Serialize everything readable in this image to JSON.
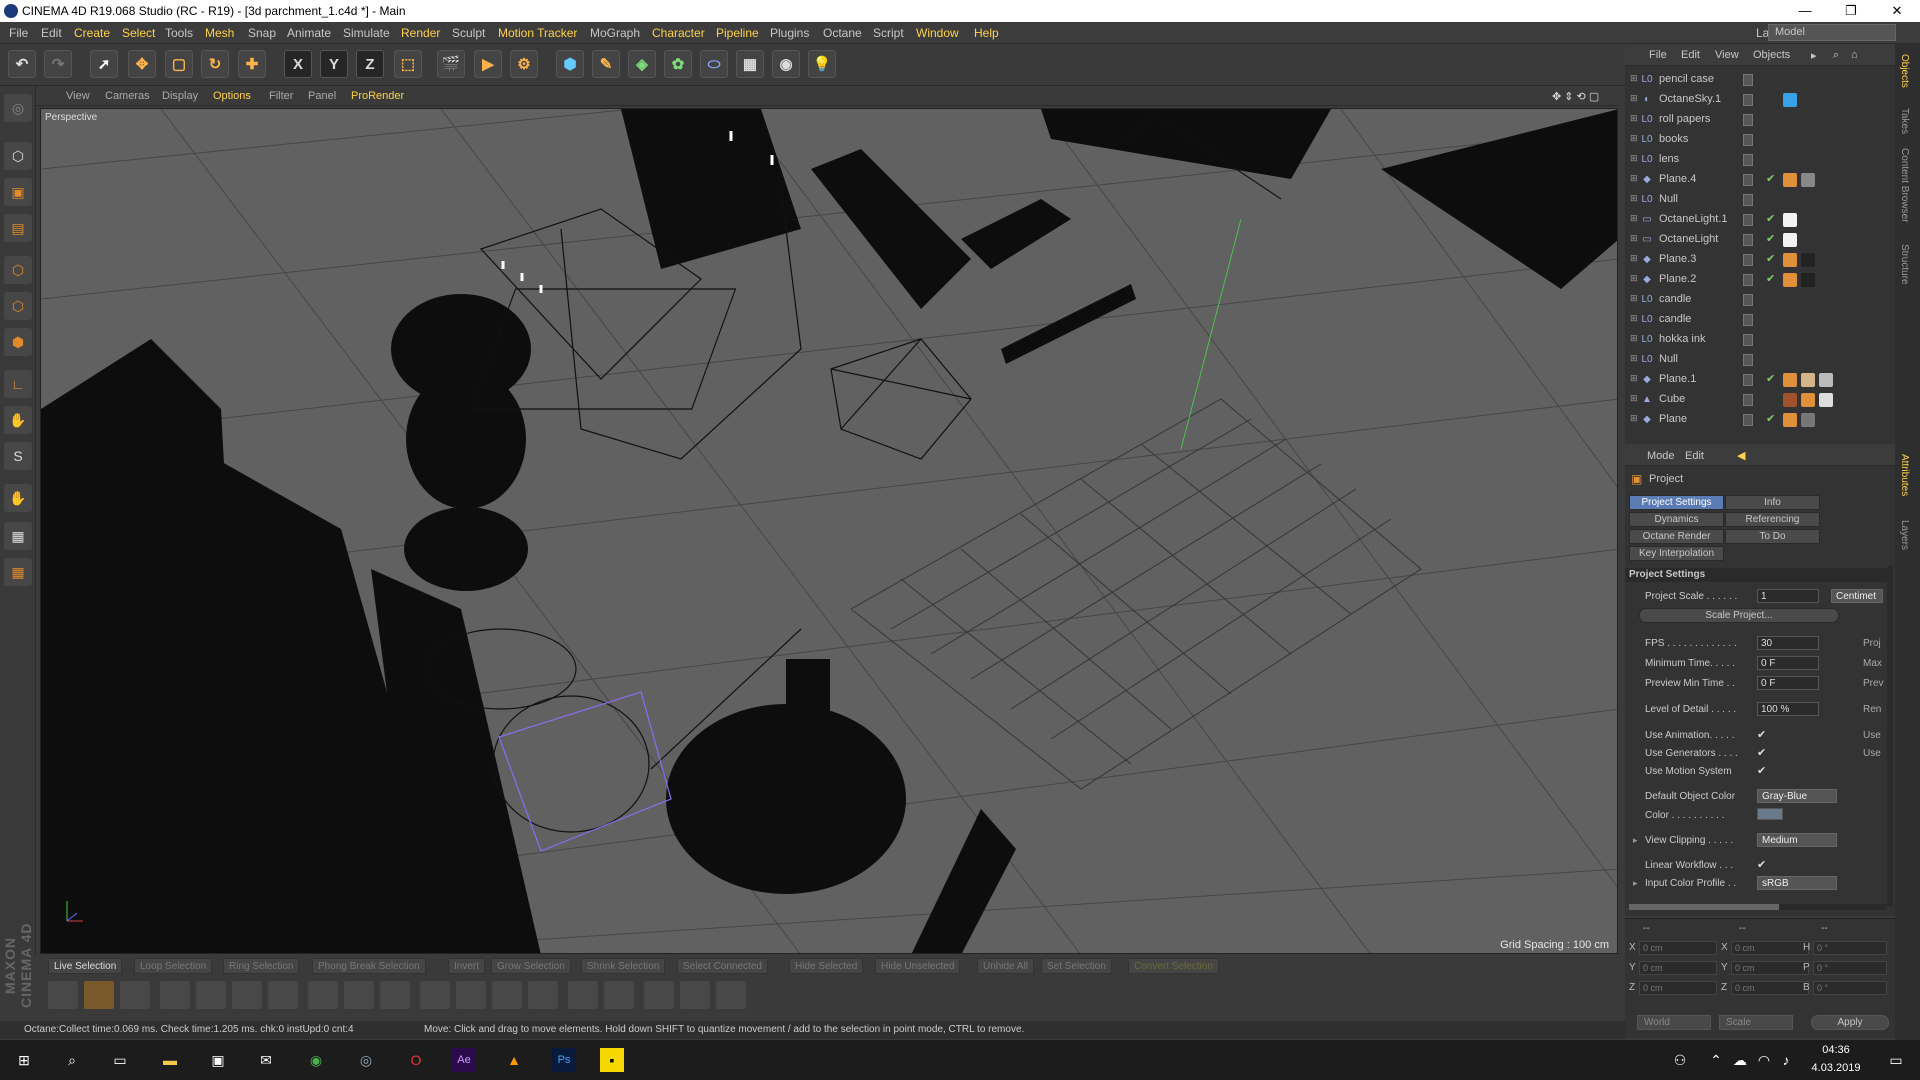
{
  "window": {
    "title": "CINEMA 4D R19.068 Studio (RC - R19) - [3d parchment_1.c4d *] - Main",
    "minimize": "—",
    "restore": "❐",
    "close": "✕"
  },
  "menu": {
    "items": [
      "File",
      "Edit",
      "Create",
      "Select",
      "Tools",
      "Mesh",
      "Snap",
      "Animate",
      "Simulate",
      "Render",
      "Sculpt",
      "Motion Tracker",
      "MoGraph",
      "Character",
      "Pipeline",
      "Plugins",
      "Octane",
      "Script",
      "Window",
      "Help"
    ],
    "layout_label": "Layout:",
    "layout_value": "Model"
  },
  "toolbar": {
    "x_label": "X",
    "y_label": "Y",
    "z_label": "Z"
  },
  "viewport": {
    "menu": [
      "View",
      "Cameras",
      "Display",
      "Options",
      "Filter",
      "Panel",
      "ProRender"
    ],
    "label": "Perspective",
    "grid_spacing": "Grid Spacing : 100 cm"
  },
  "selection_bar": [
    "Live Selection",
    "Loop Selection",
    "Ring Selection",
    "Phong Break Selection",
    "Invert",
    "Grow Selection",
    "Shrink Selection",
    "Select Connected",
    "Hide Selected",
    "Hide Unselected",
    "Unhide All",
    "Set Selection",
    "Convert Selection"
  ],
  "status": {
    "left": "Octane:Collect time:0.069 ms.  Check time:1.205 ms.  chk:0  instUpd:0  cnt:4",
    "right": "Move: Click and drag to move elements. Hold down SHIFT to quantize movement / add to the selection in point mode, CTRL to remove."
  },
  "brand": "MAXON CINEMA 4D",
  "object_manager": {
    "menu": [
      "File",
      "Edit",
      "View",
      "Objects"
    ],
    "objects": [
      {
        "name": "pencil case",
        "icon": "null-icon",
        "tags": []
      },
      {
        "name": "OctaneSky.1",
        "icon": "sky-icon",
        "tags": [
          "#3aa0e8"
        ]
      },
      {
        "name": "roll papers",
        "icon": "null-icon",
        "tags": []
      },
      {
        "name": "books",
        "icon": "null-icon",
        "tags": []
      },
      {
        "name": "lens",
        "icon": "null-icon",
        "tags": []
      },
      {
        "name": "Plane.4",
        "icon": "plane-icon",
        "tags": [
          "#e0903a",
          "#888888"
        ],
        "check": true
      },
      {
        "name": "Null",
        "icon": "null-icon",
        "tags": []
      },
      {
        "name": "OctaneLight.1",
        "icon": "light-icon",
        "tags": [
          "#f2f2f2"
        ],
        "check": true
      },
      {
        "name": "OctaneLight",
        "icon": "light-icon",
        "tags": [
          "#f2f2f2"
        ],
        "check": true
      },
      {
        "name": "Plane.3",
        "icon": "plane-icon",
        "tags": [
          "#e0903a",
          "#222222"
        ],
        "check": true
      },
      {
        "name": "Plane.2",
        "icon": "plane-icon",
        "tags": [
          "#e0903a",
          "#222222"
        ],
        "check": true
      },
      {
        "name": "candle",
        "icon": "null-icon",
        "tags": []
      },
      {
        "name": "candle",
        "icon": "null-icon",
        "tags": []
      },
      {
        "name": "hokka ink",
        "icon": "null-icon",
        "tags": []
      },
      {
        "name": "Null",
        "icon": "null-icon",
        "tags": []
      },
      {
        "name": "Plane.1",
        "icon": "plane-icon",
        "tags": [
          "#e0903a",
          "#d2b68a",
          "#bbbbbb"
        ],
        "check": true
      },
      {
        "name": "Cube",
        "icon": "cube-icon",
        "tags": [
          "#a0522d",
          "#e0903a",
          "#dddddd"
        ]
      },
      {
        "name": "Plane",
        "icon": "plane-icon",
        "tags": [
          "#e0903a",
          "#777777"
        ],
        "check": true
      }
    ]
  },
  "attributes": {
    "menu": [
      "Mode",
      "Edit"
    ],
    "header": "Project",
    "tabs": [
      "Project Settings",
      "Info",
      "Dynamics",
      "Referencing",
      "Octane Render",
      "To Do",
      "Key Interpolation"
    ],
    "section": "Project Settings",
    "project_scale_label": "Project Scale . . . . . .",
    "project_scale_value": "1",
    "project_scale_unit": "Centimet",
    "scale_button": "Scale Project...",
    "fps_label": "FPS . . . . . . . . . . . . .",
    "fps_value": "30",
    "fps_right": "Proj",
    "min_time_label": "Minimum Time. . . . .",
    "min_time_value": "0 F",
    "min_time_right": "Max",
    "preview_min_label": "Preview Min Time . .",
    "preview_min_value": "0 F",
    "preview_min_right": "Prev",
    "lod_label": "Level of Detail . . . . .",
    "lod_value": "100 %",
    "lod_right": "Ren",
    "use_anim_label": "Use Animation. . . . .",
    "use_anim_right": "Use",
    "use_gen_label": "Use Generators . . . .",
    "use_gen_right": "Use",
    "use_motion_label": "Use Motion System",
    "default_color_label": "Default Object Color",
    "default_color_value": "Gray-Blue",
    "color_label": "Color . . . . . . . . . .",
    "view_clip_label": "View Clipping . . . . .",
    "view_clip_value": "Medium",
    "linear_label": "Linear Workflow . . .",
    "input_profile_label": "Input Color Profile . .",
    "input_profile_value": "sRGB"
  },
  "coords": {
    "header": [
      "--",
      "--",
      "--"
    ],
    "rows": [
      {
        "a": "X",
        "av": "0 cm",
        "b": "X",
        "bv": "0 cm",
        "c": "H",
        "cv": "0 °"
      },
      {
        "a": "Y",
        "av": "0 cm",
        "b": "Y",
        "bv": "0 cm",
        "c": "P",
        "cv": "0 °"
      },
      {
        "a": "Z",
        "av": "0 cm",
        "b": "Z",
        "bv": "0 cm",
        "c": "B",
        "cv": "0 °"
      }
    ],
    "mode": "World",
    "scale": "Scale",
    "apply": "Apply"
  },
  "side_tabs": [
    "Objects",
    "Takes",
    "Content Browser",
    "Structure",
    "Attributes",
    "Layers"
  ],
  "taskbar": {
    "time": "04:36",
    "date": "4.03.2019"
  }
}
